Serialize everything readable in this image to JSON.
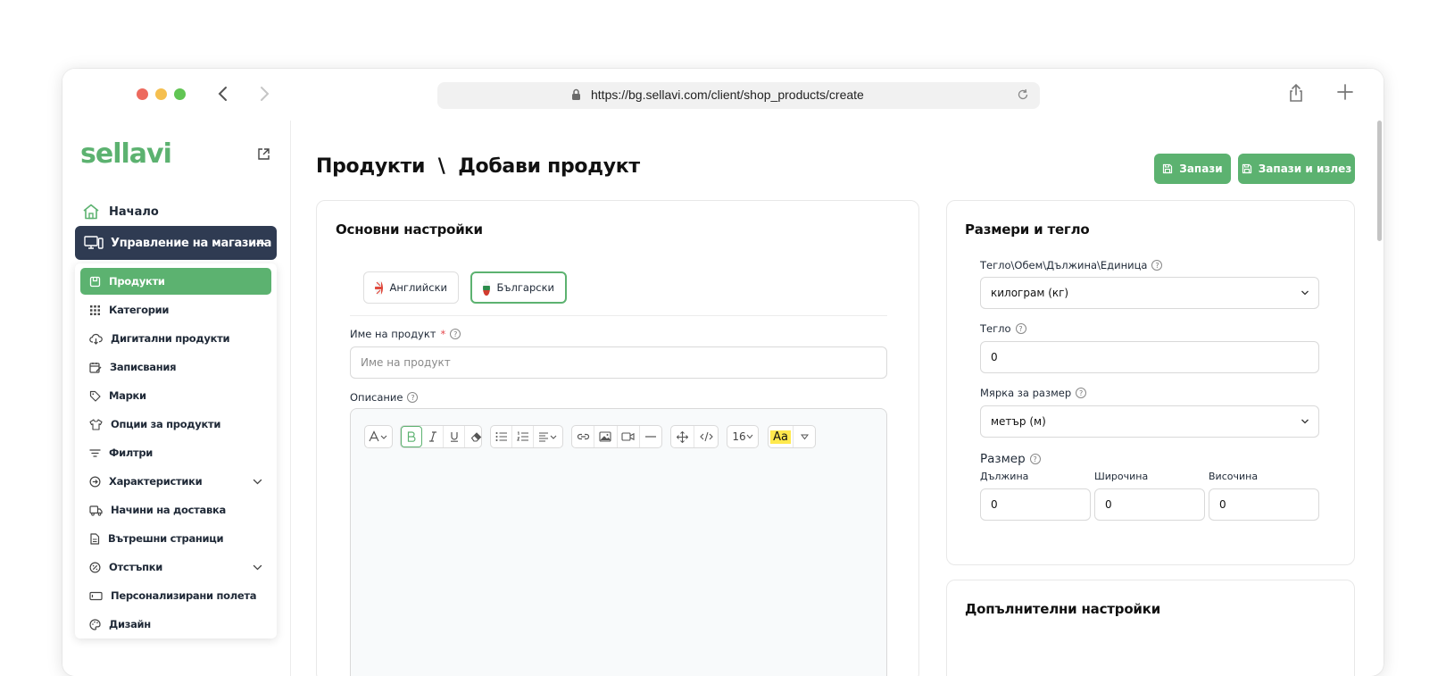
{
  "browser": {
    "url": "https://bg.sellavi.com/client/shop_products/create"
  },
  "sidebar": {
    "logo": "sellavi",
    "home_label": "Начало",
    "store_label": "Управление на магазина",
    "items": [
      {
        "label": "Продукти",
        "icon": "box-icon"
      },
      {
        "label": "Категории",
        "icon": "grid-icon"
      },
      {
        "label": "Дигитални продукти",
        "icon": "cloud-download-icon"
      },
      {
        "label": "Записвания",
        "icon": "calendar-edit-icon"
      },
      {
        "label": "Марки",
        "icon": "tag-icon"
      },
      {
        "label": "Опции за продукти",
        "icon": "shirt-icon"
      },
      {
        "label": "Филтри",
        "icon": "filter-icon"
      },
      {
        "label": "Характеристики",
        "icon": "arrow-circle-icon"
      },
      {
        "label": "Начини на доставка",
        "icon": "truck-icon"
      },
      {
        "label": "Вътрешни страници",
        "icon": "document-icon"
      },
      {
        "label": "Отстъпки",
        "icon": "discount-icon"
      },
      {
        "label": "Персонализирани полета",
        "icon": "field-icon"
      },
      {
        "label": "Дизайн",
        "icon": "palette-icon"
      }
    ]
  },
  "header": {
    "title": "Продукти  \\  Добави продукт",
    "save_label": "Запази",
    "save_exit_label": "Запази и излез"
  },
  "basic": {
    "title": "Основни настройки",
    "lang_en": "Английски",
    "lang_bg": "Български",
    "name_label": "Име на продукт",
    "name_required": "*",
    "name_placeholder": "Име на продукт",
    "description_label": "Описание",
    "font_size": "16",
    "highlight_label": "Aa"
  },
  "size": {
    "title": "Размери и тегло",
    "unit_label": "Тегло\\Обем\\Дължина\\Единица",
    "unit_value": "килограм (кг)",
    "weight_label": "Тегло",
    "weight_value": "0",
    "measure_label": "Мярка за размер",
    "measure_value": "метър (м)",
    "dimension_label": "Размер",
    "length_label": "Дължина",
    "width_label": "Широчина",
    "height_label": "Височина",
    "length_value": "0",
    "width_value": "0",
    "height_value": "0"
  },
  "extra": {
    "title": "Допълнителни настройки"
  },
  "colors": {
    "brand_green": "#5cb270",
    "sidebar_active_dark": "#2f3b52"
  }
}
